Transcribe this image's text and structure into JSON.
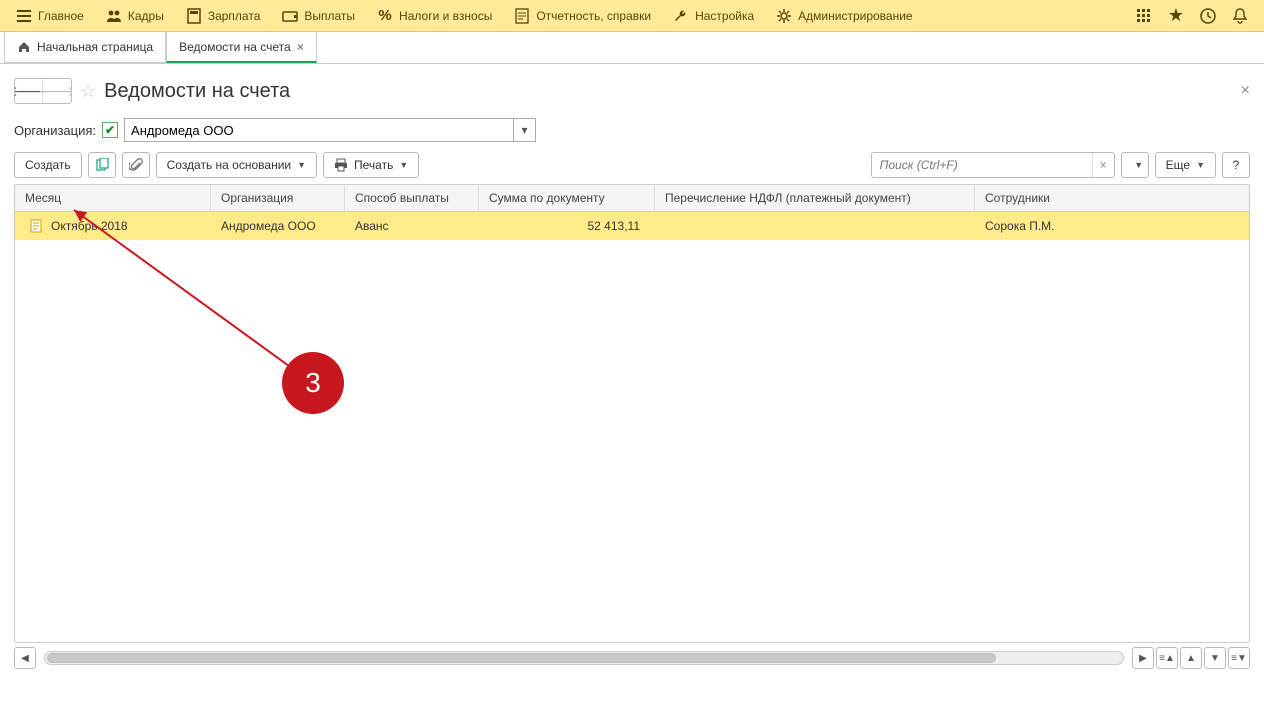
{
  "topMenu": [
    {
      "label": "Главное",
      "icon": "menu"
    },
    {
      "label": "Кадры",
      "icon": "people"
    },
    {
      "label": "Зарплата",
      "icon": "calc"
    },
    {
      "label": "Выплаты",
      "icon": "wallet"
    },
    {
      "label": "Налоги и взносы",
      "icon": "percent"
    },
    {
      "label": "Отчетность, справки",
      "icon": "report"
    },
    {
      "label": "Настройка",
      "icon": "wrench"
    },
    {
      "label": "Администрирование",
      "icon": "gear"
    }
  ],
  "tabs": {
    "home": "Начальная страница",
    "active": "Ведомости на счета"
  },
  "page": {
    "title": "Ведомости на счета",
    "orgLabel": "Организация:",
    "orgValue": "Андромеда ООО"
  },
  "toolbar": {
    "create": "Создать",
    "createFrom": "Создать на основании",
    "print": "Печать",
    "more": "Еще",
    "searchPlaceholder": "Поиск (Ctrl+F)"
  },
  "grid": {
    "headers": {
      "month": "Месяц",
      "org": "Организация",
      "payType": "Способ выплаты",
      "sum": "Сумма по документу",
      "ndfl": "Перечисление НДФЛ (платежный документ)",
      "emp": "Сотрудники"
    },
    "row": {
      "month": "Октябрь 2018",
      "org": "Андромеда ООО",
      "payType": "Аванс",
      "sum": "52 413,11",
      "ndfl": "",
      "emp": "Сорока П.М."
    }
  },
  "annotation": {
    "num": "3"
  }
}
